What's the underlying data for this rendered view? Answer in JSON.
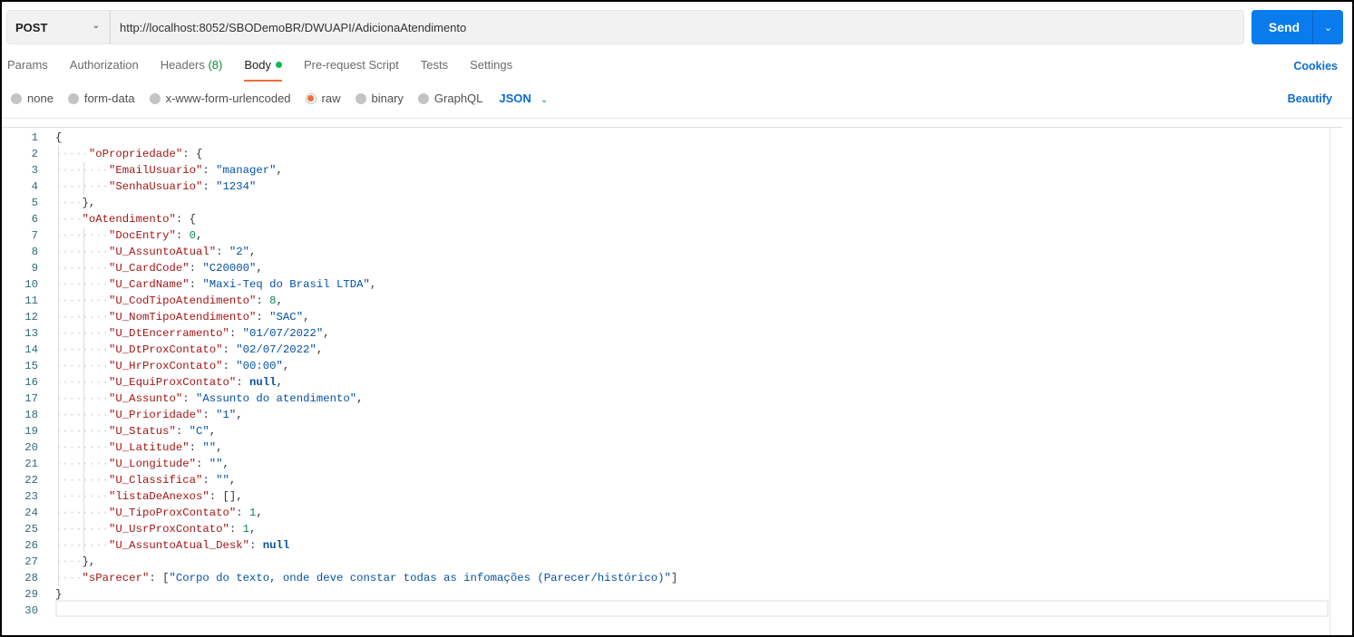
{
  "request": {
    "method": "POST",
    "url": "http://localhost:8052/SBODemoBR/DWUAPI/AdicionaAtendimento",
    "send_label": "Send"
  },
  "tabs": [
    {
      "label": "Params"
    },
    {
      "label": "Authorization"
    },
    {
      "label": "Headers",
      "count": "(8)"
    },
    {
      "label": "Body"
    },
    {
      "label": "Pre-request Script"
    },
    {
      "label": "Tests"
    },
    {
      "label": "Settings"
    }
  ],
  "cookies_label": "Cookies",
  "beautify_label": "Beautify",
  "body_types": [
    {
      "label": "none"
    },
    {
      "label": "form-data"
    },
    {
      "label": "x-www-form-urlencoded"
    },
    {
      "label": "raw",
      "selected": true
    },
    {
      "label": "binary"
    },
    {
      "label": "GraphQL"
    }
  ],
  "language": "JSON",
  "colors": {
    "accent": "#097bed",
    "tab_underline": "#f26b3a",
    "body_dot": "#0cbb52"
  },
  "code": [
    {
      "i": "",
      "t": [
        [
          "p",
          "{"
        ]
      ]
    },
    {
      "i": "·····",
      "t": [
        [
          "k",
          "\"oPropriedade\""
        ],
        [
          "p",
          ": {"
        ]
      ]
    },
    {
      "i": "········",
      "t": [
        [
          "k",
          "\"EmailUsuario\""
        ],
        [
          "p",
          ": "
        ],
        [
          "s",
          "\"manager\""
        ],
        [
          "p",
          ","
        ]
      ]
    },
    {
      "i": "········",
      "t": [
        [
          "k",
          "\"SenhaUsuario\""
        ],
        [
          "p",
          ": "
        ],
        [
          "s",
          "\"1234\""
        ]
      ]
    },
    {
      "i": "····",
      "t": [
        [
          "p",
          "},"
        ]
      ]
    },
    {
      "i": "····",
      "t": [
        [
          "k",
          "\"oAtendimento\""
        ],
        [
          "p",
          ": {"
        ]
      ]
    },
    {
      "i": "········",
      "t": [
        [
          "k",
          "\"DocEntry\""
        ],
        [
          "p",
          ": "
        ],
        [
          "n",
          "0"
        ],
        [
          "p",
          ","
        ]
      ]
    },
    {
      "i": "········",
      "t": [
        [
          "k",
          "\"U_AssuntoAtual\""
        ],
        [
          "p",
          ": "
        ],
        [
          "s",
          "\"2\""
        ],
        [
          "p",
          ","
        ]
      ]
    },
    {
      "i": "········",
      "t": [
        [
          "k",
          "\"U_CardCode\""
        ],
        [
          "p",
          ": "
        ],
        [
          "s",
          "\"C20000\""
        ],
        [
          "p",
          ","
        ]
      ]
    },
    {
      "i": "········",
      "t": [
        [
          "k",
          "\"U_CardName\""
        ],
        [
          "p",
          ": "
        ],
        [
          "s",
          "\"Maxi-Teq do Brasil LTDA\""
        ],
        [
          "p",
          ","
        ]
      ]
    },
    {
      "i": "········",
      "t": [
        [
          "k",
          "\"U_CodTipoAtendimento\""
        ],
        [
          "p",
          ": "
        ],
        [
          "n",
          "8"
        ],
        [
          "p",
          ","
        ]
      ]
    },
    {
      "i": "········",
      "t": [
        [
          "k",
          "\"U_NomTipoAtendimento\""
        ],
        [
          "p",
          ": "
        ],
        [
          "s",
          "\"SAC\""
        ],
        [
          "p",
          ","
        ]
      ]
    },
    {
      "i": "········",
      "t": [
        [
          "k",
          "\"U_DtEncerramento\""
        ],
        [
          "p",
          ": "
        ],
        [
          "s",
          "\"01/07/2022\""
        ],
        [
          "p",
          ","
        ]
      ]
    },
    {
      "i": "········",
      "t": [
        [
          "k",
          "\"U_DtProxContato\""
        ],
        [
          "p",
          ": "
        ],
        [
          "s",
          "\"02/07/2022\""
        ],
        [
          "p",
          ","
        ]
      ]
    },
    {
      "i": "········",
      "t": [
        [
          "k",
          "\"U_HrProxContato\""
        ],
        [
          "p",
          ": "
        ],
        [
          "s",
          "\"00:00\""
        ],
        [
          "p",
          ","
        ]
      ]
    },
    {
      "i": "········",
      "t": [
        [
          "k",
          "\"U_EquiProxContato\""
        ],
        [
          "p",
          ": "
        ],
        [
          "b",
          "null"
        ],
        [
          "p",
          ","
        ]
      ]
    },
    {
      "i": "········",
      "t": [
        [
          "k",
          "\"U_Assunto\""
        ],
        [
          "p",
          ": "
        ],
        [
          "s",
          "\"Assunto do atendimento\""
        ],
        [
          "p",
          ","
        ]
      ]
    },
    {
      "i": "········",
      "t": [
        [
          "k",
          "\"U_Prioridade\""
        ],
        [
          "p",
          ": "
        ],
        [
          "s",
          "\"1\""
        ],
        [
          "p",
          ","
        ]
      ]
    },
    {
      "i": "········",
      "t": [
        [
          "k",
          "\"U_Status\""
        ],
        [
          "p",
          ": "
        ],
        [
          "s",
          "\"C\""
        ],
        [
          "p",
          ","
        ]
      ]
    },
    {
      "i": "········",
      "t": [
        [
          "k",
          "\"U_Latitude\""
        ],
        [
          "p",
          ": "
        ],
        [
          "s",
          "\"\""
        ],
        [
          "p",
          ","
        ]
      ]
    },
    {
      "i": "········",
      "t": [
        [
          "k",
          "\"U_Longitude\""
        ],
        [
          "p",
          ": "
        ],
        [
          "s",
          "\"\""
        ],
        [
          "p",
          ","
        ]
      ]
    },
    {
      "i": "········",
      "t": [
        [
          "k",
          "\"U_Classifica\""
        ],
        [
          "p",
          ": "
        ],
        [
          "s",
          "\"\""
        ],
        [
          "p",
          ","
        ]
      ]
    },
    {
      "i": "········",
      "t": [
        [
          "k",
          "\"listaDeAnexos\""
        ],
        [
          "p",
          ": [],"
        ]
      ]
    },
    {
      "i": "········",
      "t": [
        [
          "k",
          "\"U_TipoProxContato\""
        ],
        [
          "p",
          ": "
        ],
        [
          "n",
          "1"
        ],
        [
          "p",
          ","
        ]
      ]
    },
    {
      "i": "········",
      "t": [
        [
          "k",
          "\"U_UsrProxContato\""
        ],
        [
          "p",
          ": "
        ],
        [
          "n",
          "1"
        ],
        [
          "p",
          ","
        ]
      ]
    },
    {
      "i": "········",
      "t": [
        [
          "k",
          "\"U_AssuntoAtual_Desk\""
        ],
        [
          "p",
          ": "
        ],
        [
          "b",
          "null"
        ]
      ]
    },
    {
      "i": "····",
      "t": [
        [
          "p",
          "},"
        ]
      ]
    },
    {
      "i": "····",
      "t": [
        [
          "k",
          "\"sParecer\""
        ],
        [
          "p",
          ": ["
        ],
        [
          "s",
          "\"Corpo do texto, onde deve constar todas as infomações (Parecer/histórico)\""
        ],
        [
          "p",
          "]"
        ]
      ]
    },
    {
      "i": "",
      "t": [
        [
          "p",
          "}"
        ]
      ]
    },
    {
      "i": "",
      "t": []
    }
  ]
}
